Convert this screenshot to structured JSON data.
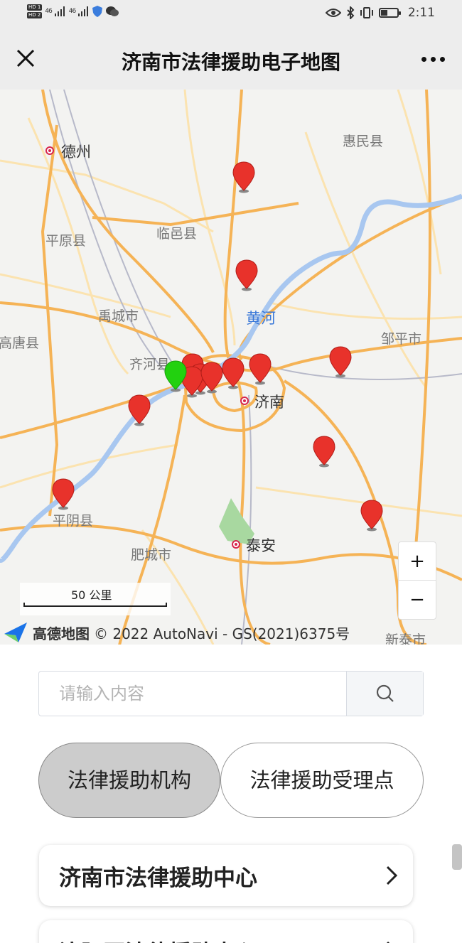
{
  "status_bar": {
    "hd1": "HD 1",
    "hd2": "HD 2",
    "signal1": "46",
    "signal2": "46",
    "time": "2:11",
    "battery_icon": "battery-icon"
  },
  "header": {
    "title": "济南市法律援助电子地图",
    "close_icon": "close-icon",
    "more_icon": "more-icon"
  },
  "map": {
    "labels": {
      "dezhou": "德州",
      "huimin": "惠民县",
      "pingyuan": "平原县",
      "linyi": "临邑县",
      "yucheng": "禹城市",
      "huanghe": "黄河",
      "gaotang": "高唐县",
      "qihe": "齐河县",
      "zouping": "邹平市",
      "jinan": "济南",
      "pingyin": "平阴县",
      "feicheng": "肥城市",
      "taian": "泰安",
      "xintai": "新泰市"
    },
    "zoom_in": "+",
    "zoom_out": "−",
    "scale_text": "50 公里",
    "brand_name": "高德地图",
    "copyright": "© 2022 AutoNavi - GS(2021)6375号",
    "marker_colors": {
      "default": "#e8322b",
      "selected": "#22d10f"
    },
    "road_color": "#f5b356",
    "river_color": "#a8c7f0"
  },
  "search": {
    "placeholder": "请输入内容",
    "icon": "search-icon"
  },
  "tabs": [
    {
      "label": "法律援助机构",
      "active": true
    },
    {
      "label": "法律援助受理点",
      "active": false
    }
  ],
  "list": [
    {
      "name": "济南市法律援助中心"
    },
    {
      "name": "济阳区法律援助中心"
    }
  ]
}
